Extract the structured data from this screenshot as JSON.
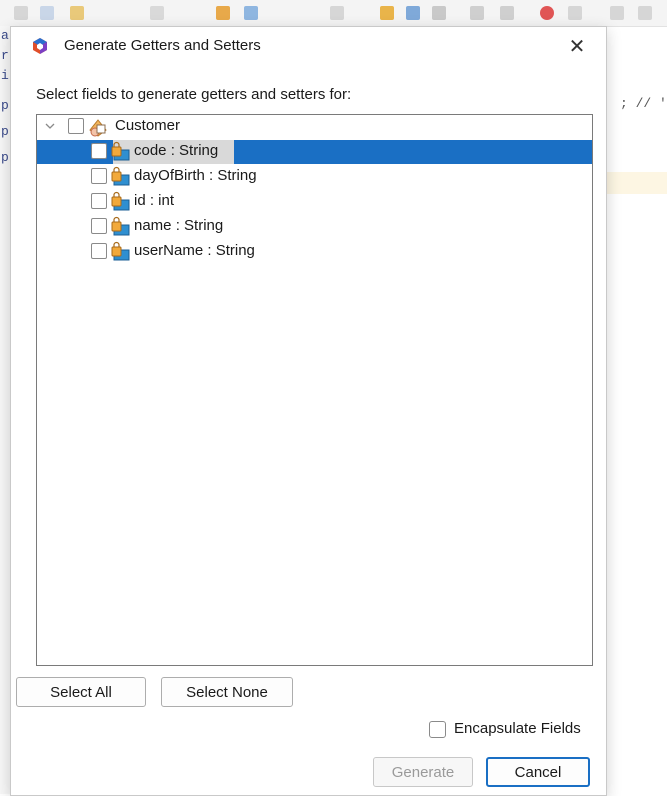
{
  "dialog": {
    "title": "Generate Getters and Setters",
    "close_glyph": "✕",
    "prompt": "Select fields to generate getters and setters for:"
  },
  "tree": {
    "root": {
      "label": "Customer",
      "icon": "class-icon",
      "checked": false,
      "expanded": true
    },
    "fields": [
      {
        "label": "code : String",
        "icon": "private-field-icon",
        "checked": false,
        "selected": true
      },
      {
        "label": "dayOfBirth : String",
        "icon": "private-field-icon",
        "checked": false,
        "selected": false
      },
      {
        "label": "id : int",
        "icon": "private-field-icon",
        "checked": false,
        "selected": false
      },
      {
        "label": "name : String",
        "icon": "private-field-icon",
        "checked": false,
        "selected": false
      },
      {
        "label": "userName : String",
        "icon": "private-field-icon",
        "checked": false,
        "selected": false
      }
    ]
  },
  "buttons": {
    "select_all": "Select All",
    "select_none": "Select None",
    "generate": "Generate",
    "cancel": "Cancel"
  },
  "options": {
    "encapsulate_fields": {
      "label": "Encapsulate Fields",
      "checked": false
    }
  },
  "background_editor": {
    "gutter_letters": [
      "a",
      "r",
      "i",
      "p",
      "p",
      "p"
    ],
    "code_fragment": "; // '"
  },
  "colors": {
    "selection": "#1a6fc4",
    "accent": "#1a6fc4"
  }
}
